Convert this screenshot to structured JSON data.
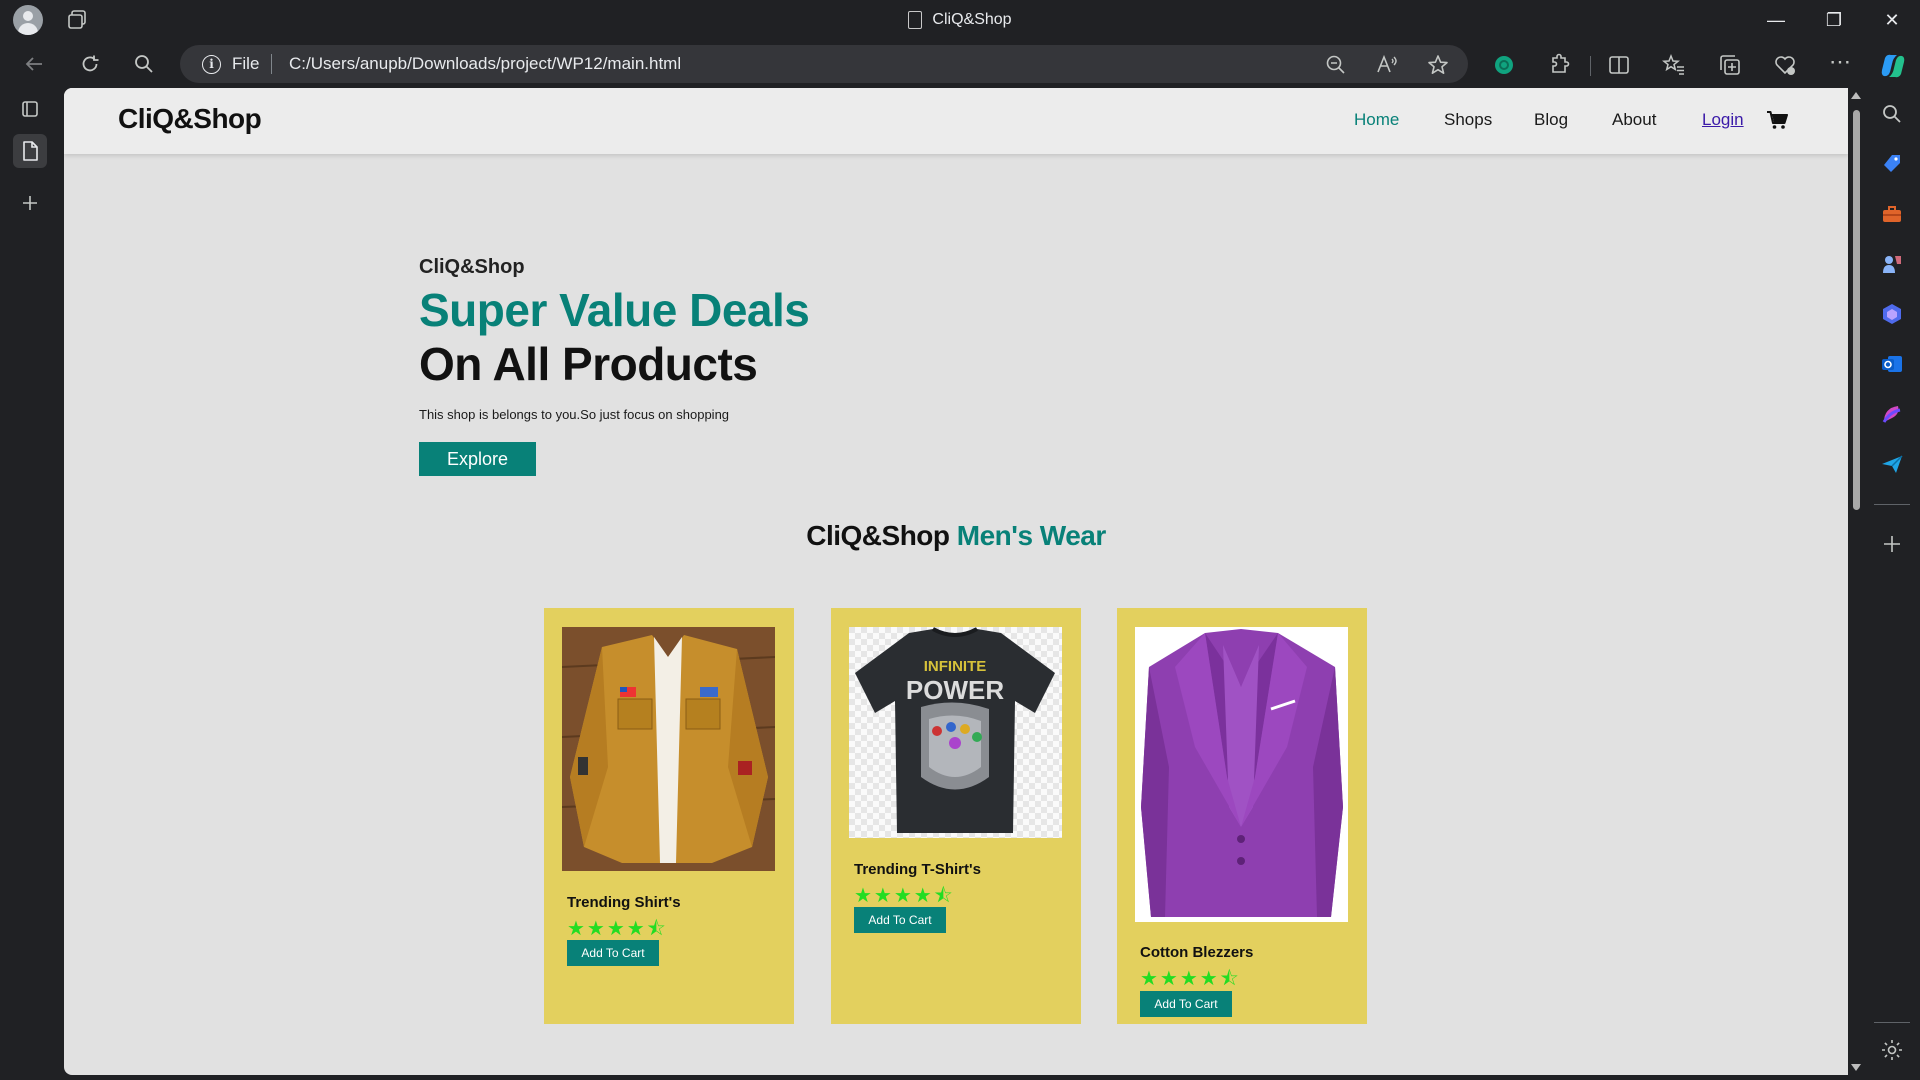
{
  "browser": {
    "window_title": "CliQ&Shop",
    "address": {
      "scheme_label": "File",
      "url": "C:/Users/anupb/Downloads/project/WP12/main.html"
    },
    "window_controls": {
      "minimize": "—",
      "restore": "❐",
      "close": "✕"
    }
  },
  "site": {
    "logo": "CliQ&Shop",
    "nav": {
      "home": "Home",
      "shops": "Shops",
      "blog": "Blog",
      "about": "About",
      "login": "Login"
    }
  },
  "hero": {
    "brand": "CliQ&Shop",
    "headline_1": "Super Value Deals",
    "headline_2": "On All Products",
    "tagline": "This shop is belongs to you.So just focus on shopping",
    "cta": "Explore"
  },
  "section": {
    "title_brand": "CliQ&Shop",
    "title_accent": "Men's Wear"
  },
  "products": [
    {
      "name": "Trending Shirt's",
      "rating": 4.5,
      "stars": "★★★★⯪",
      "button": "Add To Cart"
    },
    {
      "name": "Trending T-Shirt's",
      "rating": 4.5,
      "stars": "★★★★⯪",
      "button": "Add To Cart",
      "print_line_1": "INFINITE",
      "print_line_2": "POWER"
    },
    {
      "name": "Cotton Blezzers",
      "rating": 4.5,
      "stars": "★★★★⯪",
      "button": "Add To Cart"
    }
  ],
  "colors": {
    "accent": "#088178",
    "card_bg": "#e3d05e",
    "page_bg": "#e1e1e1",
    "star": "#22dd22",
    "browser_chrome": "#202124"
  },
  "icons": {
    "cart": "shopping-cart-icon",
    "address_info": "info-icon"
  }
}
